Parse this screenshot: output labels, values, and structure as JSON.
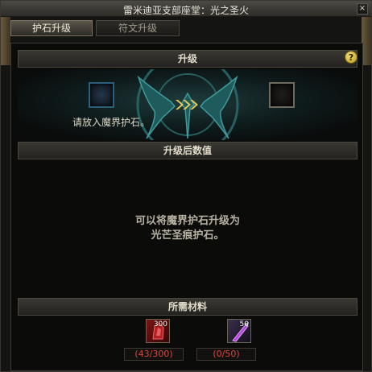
{
  "window": {
    "title": "雷米迪亚支部座堂：光之圣火",
    "close_label": "×"
  },
  "tabs": [
    {
      "label": "护石升级",
      "active": true
    },
    {
      "label": "符文升级",
      "active": false
    }
  ],
  "upgrade": {
    "header": "升级",
    "help_label": "?",
    "place_hint": "请放入魔界护石。",
    "arrow_icon": "triple-chevron-right"
  },
  "result": {
    "header": "升级后数值",
    "description_line1": "可以将魔界护石升级为",
    "description_line2": "光芒圣痕护石。"
  },
  "materials": {
    "header": "所需材料",
    "items": [
      {
        "stack": "300",
        "count": "(43/300)",
        "icon": "red-crystal-icon"
      },
      {
        "stack": "50",
        "count": "(0/50)",
        "icon": "purple-shard-icon"
      }
    ]
  },
  "colors": {
    "accent": "#d64a3a",
    "gold": "#e8c85a",
    "teal": "#1f3c3d"
  }
}
